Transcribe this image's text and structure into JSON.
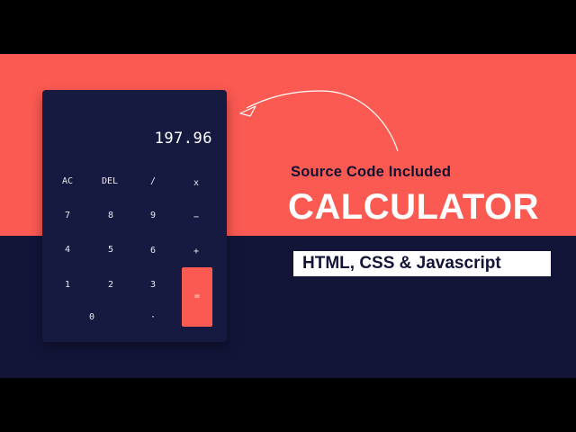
{
  "calculator": {
    "display_value": "197.96",
    "keys": {
      "ac": "AC",
      "del": "DEL",
      "divide": "/",
      "multiply": "x",
      "seven": "7",
      "eight": "8",
      "nine": "9",
      "minus": "−",
      "four": "4",
      "five": "5",
      "six": "6",
      "plus": "+",
      "one": "1",
      "two": "2",
      "three": "3",
      "equals": "=",
      "zero": "0",
      "decimal": "·"
    },
    "colors": {
      "body": "#171a40",
      "equals_key": "#fb5a52"
    }
  },
  "promo": {
    "subtitle": "Source Code Included",
    "title": "CALCULATOR",
    "tech_stack": "HTML, CSS & Javascript"
  },
  "colors": {
    "coral": "#fb5a52",
    "navy": "#121538",
    "white": "#ffffff"
  },
  "icons": {
    "arrow": "curved-arrow-icon"
  }
}
